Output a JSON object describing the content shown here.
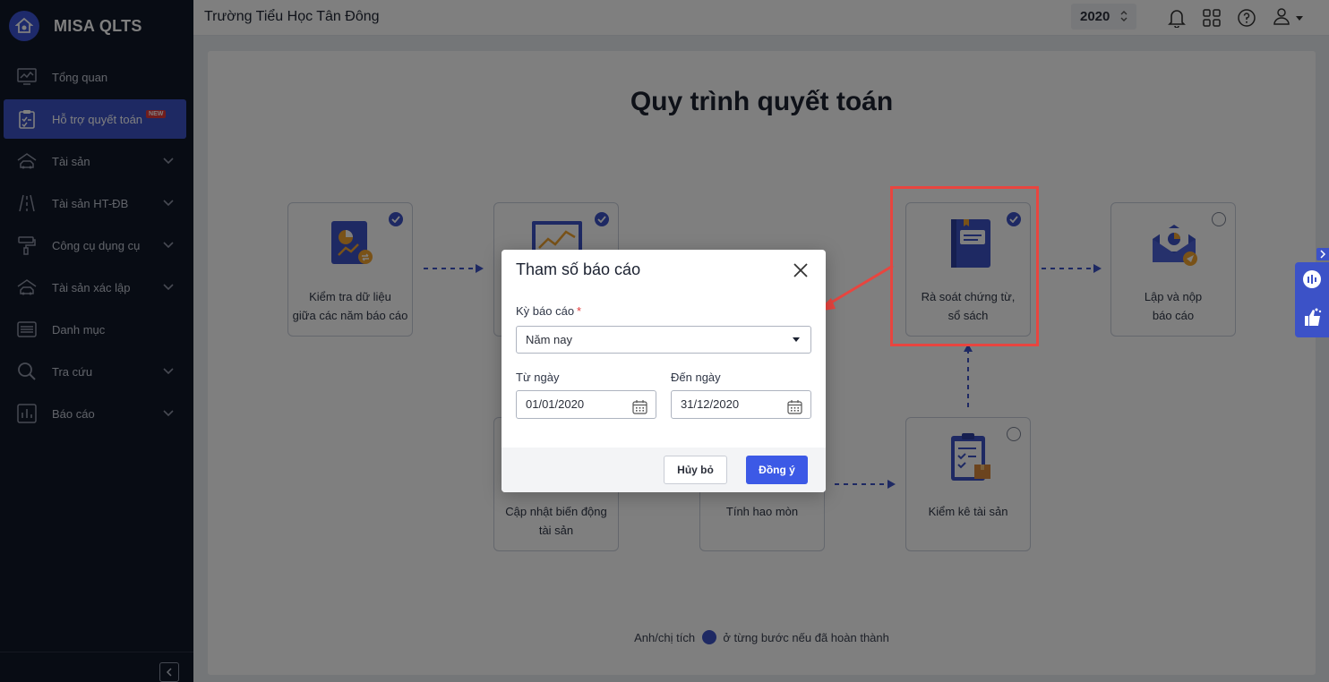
{
  "app": {
    "name": "MISA QLTS"
  },
  "header": {
    "school": "Trường Tiểu Học Tân Đông",
    "year": "2020"
  },
  "sidebar": {
    "items": [
      {
        "label": "Tổng quan",
        "icon": "chart-monitor-icon",
        "has_chevron": false
      },
      {
        "label": "Hỗ trợ quyết toán",
        "icon": "clipboard-check-icon",
        "badge": "NEW",
        "active": true
      },
      {
        "label": "Tài sản",
        "icon": "car-house-icon",
        "has_chevron": true
      },
      {
        "label": "Tài sản HT-ĐB",
        "icon": "road-icon",
        "has_chevron": true
      },
      {
        "label": "Công cụ dụng cụ",
        "icon": "paint-roller-icon",
        "has_chevron": true
      },
      {
        "label": "Tài sản xác lập",
        "icon": "car-house-icon",
        "has_chevron": true
      },
      {
        "label": "Danh mục",
        "icon": "list-icon",
        "has_chevron": false
      },
      {
        "label": "Tra cứu",
        "icon": "search-icon",
        "has_chevron": true
      },
      {
        "label": "Báo cáo",
        "icon": "bar-chart-icon",
        "has_chevron": true
      }
    ]
  },
  "main": {
    "title": "Quy trình quyết toán",
    "steps": [
      {
        "label_line1": "Kiểm tra dữ liệu",
        "label_line2": "giữa các năm báo cáo",
        "done": true
      },
      {
        "label_line1": "",
        "label_line2": "",
        "done": true
      },
      {
        "label_line1": "Rà soát chứng từ,",
        "label_line2": "sổ sách",
        "done": true
      },
      {
        "label_line1": "Lập và nộp",
        "label_line2": "báo cáo",
        "done": false
      },
      {
        "label_line1": "Cập nhật biến động",
        "label_line2": "tài sản",
        "done": false
      },
      {
        "label_line1": "Tính hao mòn",
        "label_line2": "",
        "done": false
      },
      {
        "label_line1": "Kiểm kê tài sản",
        "label_line2": "",
        "done": false
      }
    ],
    "hint_before": "Anh/chị tích",
    "hint_after": "ở từng bước nếu đã hoàn thành"
  },
  "dialog": {
    "title": "Tham số báo cáo",
    "period_label": "Kỳ báo cáo",
    "period_value": "Năm nay",
    "from_label": "Từ ngày",
    "from_value": "01/01/2020",
    "to_label": "Đến ngày",
    "to_value": "31/12/2020",
    "cancel_label": "Hủy bỏ",
    "ok_label": "Đồng ý"
  },
  "colors": {
    "accent": "#3c52c7",
    "highlight": "#e8453f",
    "sidebar_bg": "#111828"
  }
}
